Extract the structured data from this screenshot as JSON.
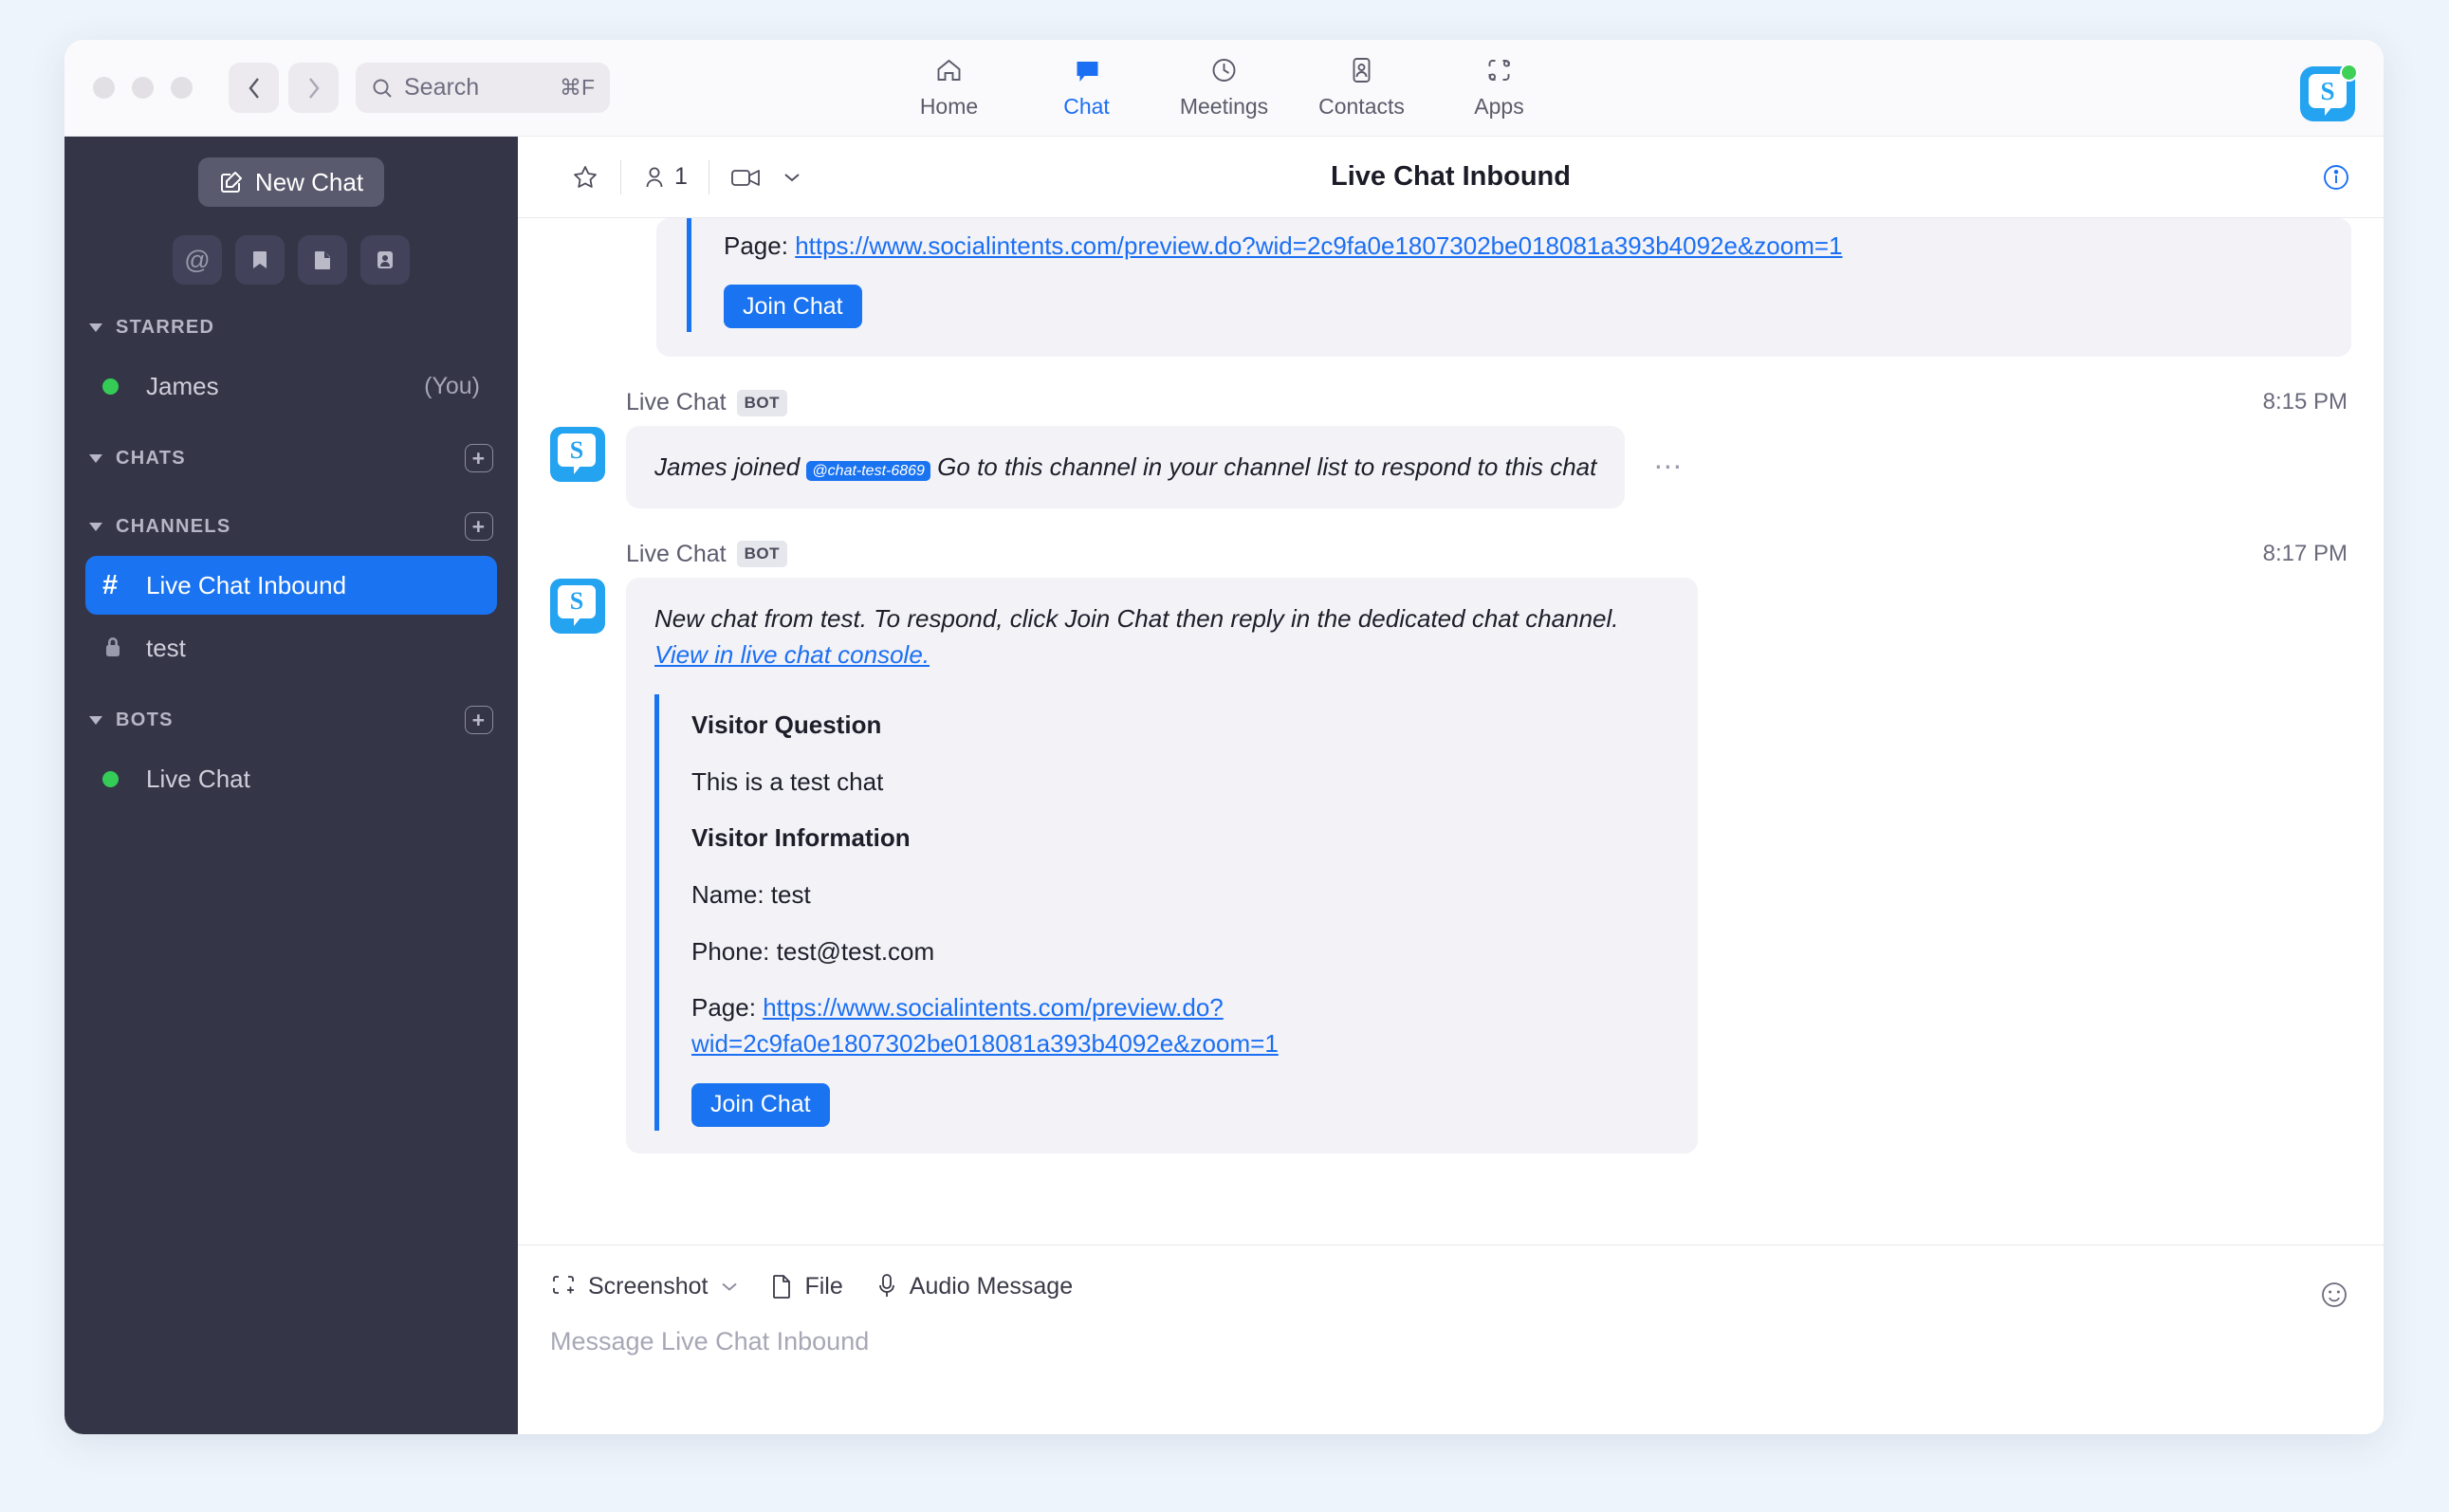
{
  "titlebar": {
    "search_placeholder": "Search",
    "search_shortcut": "⌘F",
    "back_icon": "chevron-left-icon",
    "forward_icon": "chevron-right-icon"
  },
  "topnav": [
    {
      "label": "Home",
      "icon": "home-icon",
      "active": false
    },
    {
      "label": "Chat",
      "icon": "chat-bubble-icon",
      "active": true
    },
    {
      "label": "Meetings",
      "icon": "clock-icon",
      "active": false
    },
    {
      "label": "Contacts",
      "icon": "contact-card-icon",
      "active": false
    },
    {
      "label": "Apps",
      "icon": "apps-icon",
      "active": false
    }
  ],
  "sidebar": {
    "new_chat_label": "New Chat",
    "quick_icons": [
      "at-icon",
      "bookmark-icon",
      "draft-icon",
      "contact-icon"
    ],
    "sections": [
      {
        "title": "STARRED",
        "has_add": false,
        "items": [
          {
            "label": "James",
            "suffix": "(You)",
            "icon": "presence-online-icon",
            "selected": false
          }
        ]
      },
      {
        "title": "CHATS",
        "has_add": true,
        "items": []
      },
      {
        "title": "CHANNELS",
        "has_add": true,
        "items": [
          {
            "label": "Live Chat Inbound",
            "suffix": "",
            "icon": "hash-icon",
            "selected": true
          },
          {
            "label": "test",
            "suffix": "",
            "icon": "lock-icon",
            "selected": false
          }
        ]
      },
      {
        "title": "BOTS",
        "has_add": true,
        "items": [
          {
            "label": "Live Chat",
            "suffix": "",
            "icon": "presence-online-icon",
            "selected": false
          }
        ]
      }
    ]
  },
  "chat_header": {
    "title": "Live Chat Inbound",
    "star_icon": "star-icon",
    "participants_count": "1",
    "participants_icon": "person-icon",
    "video_icon": "video-camera-icon",
    "video_caret": "chevron-down-icon",
    "info_icon": "info-circle-icon"
  },
  "messages": {
    "scrolled_card": {
      "page_label": "Page:",
      "page_url": "https://www.socialintents.com/preview.do?wid=2c9fa0e1807302be018081a393b4092e&zoom=1",
      "join_label": "Join Chat"
    },
    "list": [
      {
        "sender": "Live Chat",
        "badge": "BOT",
        "time": "8:15 PM",
        "text_before": "James joined ",
        "mention": "@chat-test-6869",
        "text_after": " Go to this channel in your channel list to respond to this chat",
        "overflow": "…"
      },
      {
        "sender": "Live Chat",
        "badge": "BOT",
        "time": "8:17 PM",
        "intro": "New chat from test.  To respond, click Join Chat then reply in the dedicated chat channel. ",
        "intro_link": "View in live chat console.",
        "details": [
          {
            "label": "Visitor Question",
            "bold": true
          },
          {
            "label": "This is a test chat",
            "bold": false
          },
          {
            "label": "Visitor Information",
            "bold": true
          },
          {
            "label": "Name: test",
            "bold": false
          },
          {
            "label": "Phone: test@test.com",
            "bold": false
          }
        ],
        "page_label": "Page:",
        "page_url": "https://www.socialintents.com/preview.do?wid=2c9fa0e1807302be018081a393b4092e&zoom=1",
        "join_label": "Join Chat"
      }
    ]
  },
  "composer": {
    "tools": [
      {
        "label": "Screenshot",
        "icon": "screenshot-icon",
        "has_caret": true
      },
      {
        "label": "File",
        "icon": "file-icon",
        "has_caret": false
      },
      {
        "label": "Audio Message",
        "icon": "microphone-icon",
        "has_caret": false
      }
    ],
    "placeholder": "Message Live Chat Inbound",
    "emoji_icon": "emoji-smiley-icon"
  },
  "colors": {
    "accent": "#1a73f0",
    "sidebar_bg": "#353548",
    "bubble_bg": "#f2f2f7",
    "online": "#34cc57"
  }
}
